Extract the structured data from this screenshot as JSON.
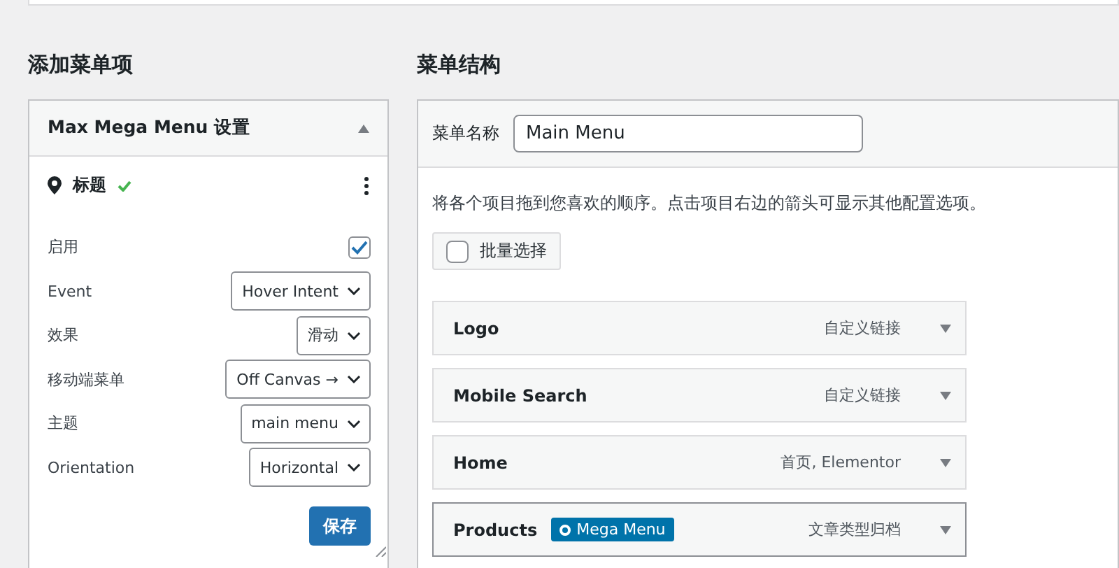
{
  "left": {
    "heading": "添加菜单项",
    "panel": {
      "title": "Max Mega Menu 设置",
      "expanded": true,
      "item_title": "标题",
      "item_ok": true,
      "fields": [
        {
          "kind": "checkbox",
          "label": "启用",
          "checked": true
        },
        {
          "kind": "select",
          "label": "Event",
          "value": "Hover Intent"
        },
        {
          "kind": "select",
          "label": "效果",
          "value": "滑动"
        },
        {
          "kind": "select",
          "label": "移动端菜单",
          "value": "Off Canvas →"
        },
        {
          "kind": "select",
          "label": "主题",
          "value": "main menu"
        },
        {
          "kind": "select",
          "label": "Orientation",
          "value": "Horizontal"
        }
      ],
      "save": "保存"
    }
  },
  "right": {
    "heading": "菜单结构",
    "name_label": "菜单名称",
    "name_value": "Main Menu",
    "instructions": "将各个项目拖到您喜欢的顺序。点击项目右边的箭头可显示其他配置选项。",
    "bulk": {
      "label": "批量选择",
      "checked": false
    },
    "items": [
      {
        "title": "Logo",
        "type": "自定义链接",
        "focused": false
      },
      {
        "title": "Mobile Search",
        "type": "自定义链接",
        "focused": false
      },
      {
        "title": "Home",
        "type": "首页, Elementor",
        "focused": false
      },
      {
        "title": "Products",
        "badge": "Mega Menu",
        "type": "文章类型归档",
        "focused": true
      }
    ]
  }
}
